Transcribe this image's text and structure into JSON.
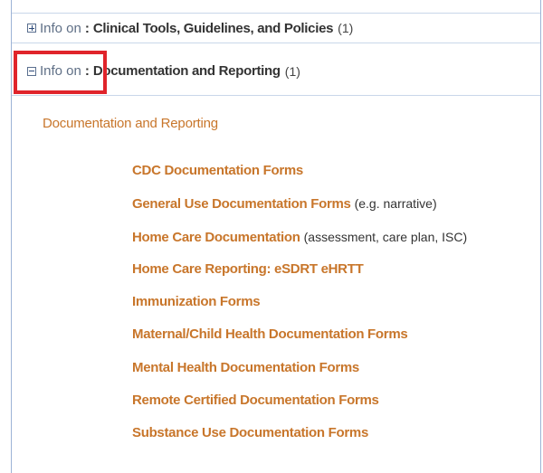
{
  "accordion": [
    {
      "state": "collapsed",
      "prefix": "Info on",
      "colon": ":",
      "title": "Clinical Tools, Guidelines, and Policies",
      "count": "(1)"
    },
    {
      "state": "expanded",
      "prefix": "Info on",
      "colon": ":",
      "title": "Documentation and Reporting",
      "count": "(1)"
    }
  ],
  "section": {
    "heading": "Documentation and Reporting",
    "links": [
      {
        "label": "CDC Documentation Forms",
        "suffix": ""
      },
      {
        "label": "General Use Documentation Forms",
        "suffix": "(e.g. narrative)"
      },
      {
        "label": "Home Care Documentation",
        "suffix": "(assessment, care plan, ISC)"
      },
      {
        "label": "Home Care Reporting: eSDRT eHRTT",
        "suffix": ""
      },
      {
        "label": "Immunization Forms",
        "suffix": ""
      },
      {
        "label": "Maternal/Child Health Documentation Forms",
        "suffix": ""
      },
      {
        "label": "Mental Health Documentation Forms",
        "suffix": ""
      },
      {
        "label": "Remote Certified Documentation Forms",
        "suffix": ""
      },
      {
        "label": "Substance Use Documentation Forms",
        "suffix": ""
      }
    ]
  },
  "colors": {
    "link": "#c8762b",
    "highlight": "#e0242b",
    "border": "#9db3d6"
  },
  "icons": {
    "collapsed": "plus-box-icon",
    "expanded": "minus-box-icon"
  }
}
